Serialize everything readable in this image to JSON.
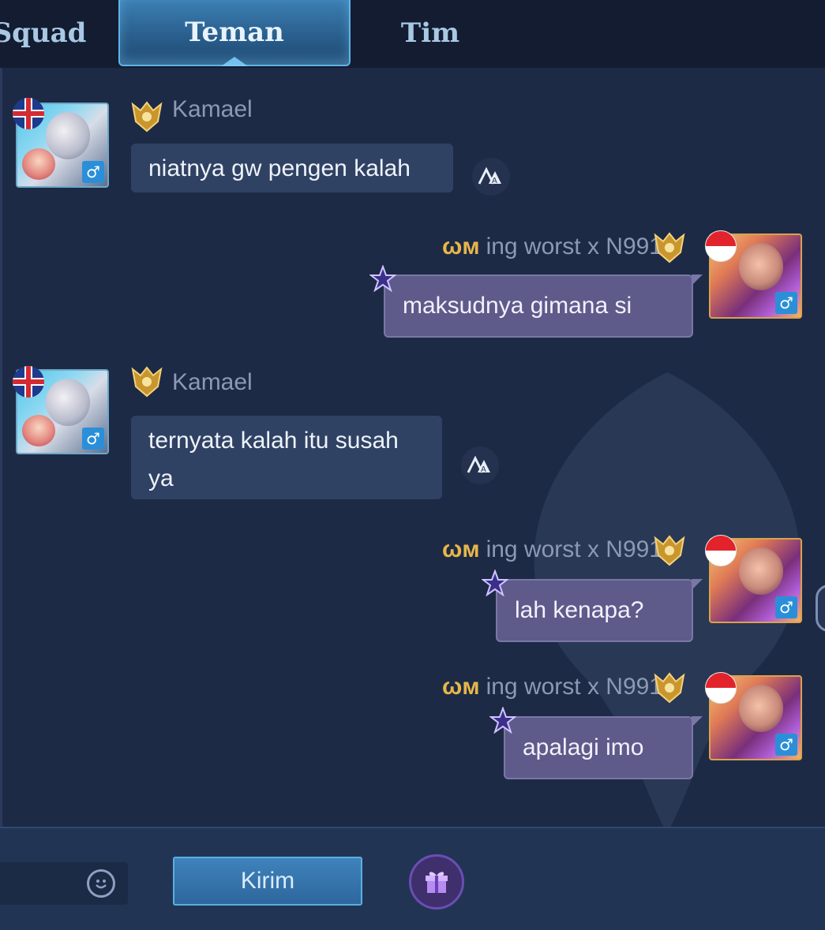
{
  "tabs": {
    "squad": "Squad",
    "teman": "Teman",
    "tim": "Tim"
  },
  "messages": [
    {
      "sender": "Kamael",
      "text": "niatnya gw pengen kalah",
      "direction": "incoming"
    },
    {
      "sender_tag": "ωм",
      "sender": "ing worst x N991",
      "text": "maksudnya gimana si",
      "direction": "outgoing"
    },
    {
      "sender": "Kamael",
      "text_line1": "ternyata kalah itu susah",
      "text_line2": "ya",
      "direction": "incoming"
    },
    {
      "sender_tag": "ωм",
      "sender": "ing worst x N991",
      "text": "lah kenapa?",
      "direction": "outgoing"
    },
    {
      "sender_tag": "ωм",
      "sender": "ing worst x N991",
      "text": "apalagi imo",
      "direction": "outgoing"
    }
  ],
  "icons": {
    "translate": "translate-icon",
    "gender": "♂",
    "emoji": "emoji-icon",
    "gift": "gift-icon"
  },
  "composer": {
    "send_label": "Kirim"
  },
  "colors": {
    "background": "#1d2a45",
    "incoming_bubble": "#304263",
    "outgoing_bubble": "#5e5b8a",
    "accent": "#5aaee0",
    "tag_gold": "#e6b64a"
  }
}
